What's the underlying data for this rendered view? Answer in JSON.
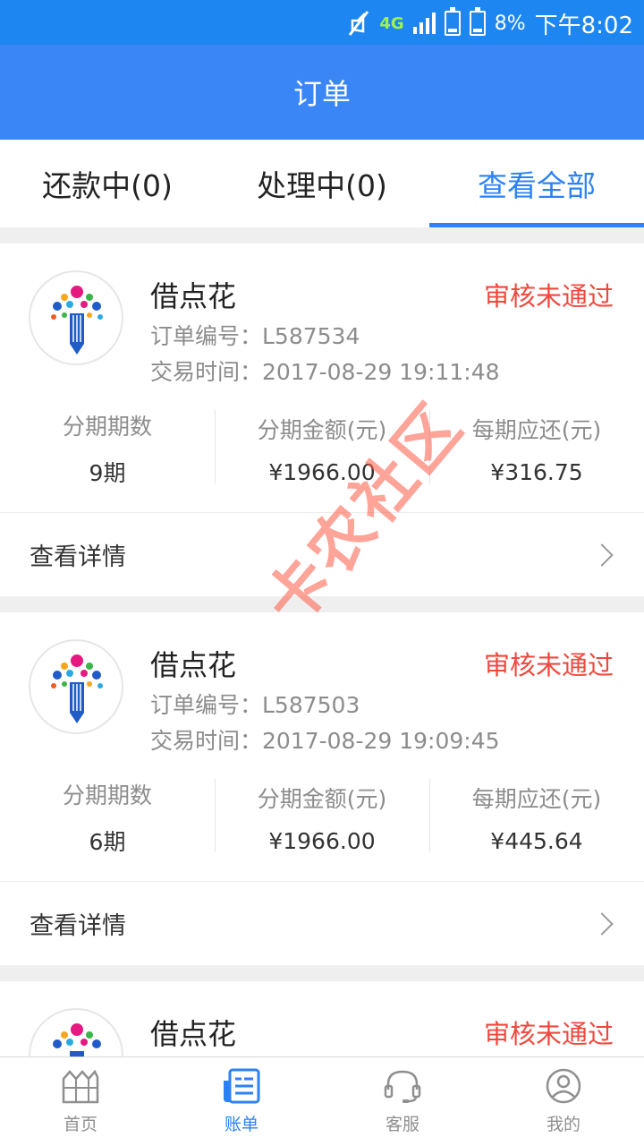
{
  "status_bar": {
    "network": "4G",
    "battery": "8%",
    "time": "下午8:02"
  },
  "header": {
    "title": "订单"
  },
  "tabs": [
    {
      "label": "还款中(0)",
      "active": false
    },
    {
      "label": "处理中(0)",
      "active": false
    },
    {
      "label": "查看全部",
      "active": true
    }
  ],
  "orders": [
    {
      "merchant": "借点花",
      "status": "审核未通过",
      "order_no": "订单编号：L587534",
      "time": "交易时间：2017-08-29 19:11:48",
      "stats": [
        {
          "label": "分期期数",
          "value": "9期"
        },
        {
          "label": "分期金额(元)",
          "value": "¥1966.00"
        },
        {
          "label": "每期应还(元)",
          "value": "¥316.75"
        }
      ],
      "detail": "查看详情"
    },
    {
      "merchant": "借点花",
      "status": "审核未通过",
      "order_no": "订单编号：L587503",
      "time": "交易时间：2017-08-29 19:09:45",
      "stats": [
        {
          "label": "分期期数",
          "value": "6期"
        },
        {
          "label": "分期金额(元)",
          "value": "¥1966.00"
        },
        {
          "label": "每期应还(元)",
          "value": "¥445.64"
        }
      ],
      "detail": "查看详情"
    },
    {
      "merchant": "借点花",
      "status": "审核未通过"
    }
  ],
  "bottom_nav": [
    {
      "label": "首页",
      "icon": "home-icon"
    },
    {
      "label": "账单",
      "icon": "bill-icon"
    },
    {
      "label": "客服",
      "icon": "headset-icon"
    },
    {
      "label": "我的",
      "icon": "user-icon"
    }
  ],
  "watermark": "卡农社区",
  "colors": {
    "primary": "#3a86f7",
    "status_bar": "#1d86f0",
    "rejected": "#f0483e",
    "accent": "#2b82f6"
  }
}
